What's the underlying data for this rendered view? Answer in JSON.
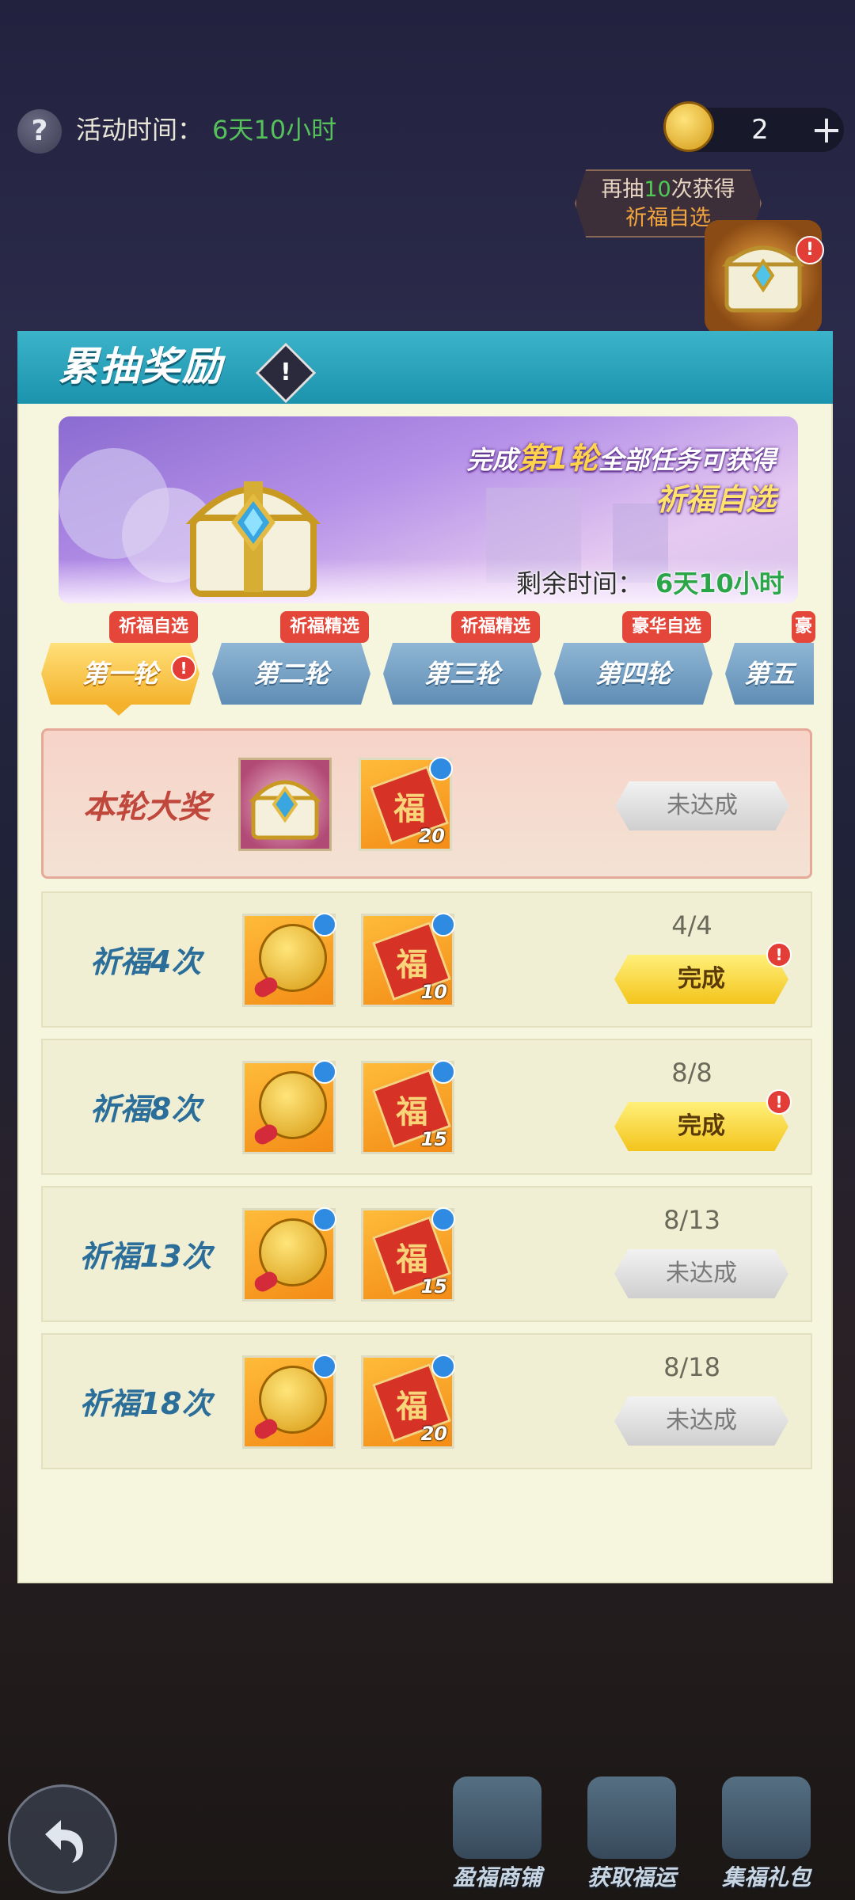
{
  "top_bar": {
    "help_icon": "?",
    "activity_label": "活动时间：",
    "activity_value": "6天10小时",
    "coin_count": "2",
    "add_icon": "+"
  },
  "hint": {
    "line1_prefix": "再抽",
    "line1_count": "10",
    "line1_suffix": "次获得",
    "line2": "祈福自选"
  },
  "panel": {
    "title": "累抽奖励",
    "info_icon": "!",
    "banner": {
      "line1_prefix": "完成",
      "line1_highlight": "第1轮",
      "line1_suffix": "全部任务可获得",
      "line2": "祈福自选",
      "time_label": "剩余时间：",
      "time_value": "6天10小时"
    },
    "tabs": [
      {
        "label": "第一轮",
        "badge": "祈福自选",
        "active": true
      },
      {
        "label": "第二轮",
        "badge": "祈福精选",
        "active": false
      },
      {
        "label": "第三轮",
        "badge": "祈福精选",
        "active": false
      },
      {
        "label": "第四轮",
        "badge": "豪华自选",
        "active": false
      },
      {
        "label": "第五",
        "badge": "豪",
        "active": false
      }
    ],
    "grand_prize": {
      "label": "本轮大奖",
      "item2_qty": "20",
      "button": "未达成"
    },
    "rows": [
      {
        "label": "祈福4次",
        "qty": "10",
        "progress": "4/4",
        "button": "完成",
        "done": true
      },
      {
        "label": "祈福8次",
        "qty": "15",
        "progress": "8/8",
        "button": "完成",
        "done": true
      },
      {
        "label": "祈福13次",
        "qty": "15",
        "progress": "8/13",
        "button": "未达成",
        "done": false
      },
      {
        "label": "祈福18次",
        "qty": "20",
        "progress": "8/18",
        "button": "未达成",
        "done": false
      }
    ]
  },
  "bottom": {
    "buttons": [
      "盈福商铺",
      "获取福运",
      "集福礼包"
    ]
  },
  "colors": {
    "accent_blue": "#1c93ad",
    "highlight_green": "#56c05a",
    "alert_red": "#e23d37",
    "done_yellow": "#f3c41c"
  }
}
